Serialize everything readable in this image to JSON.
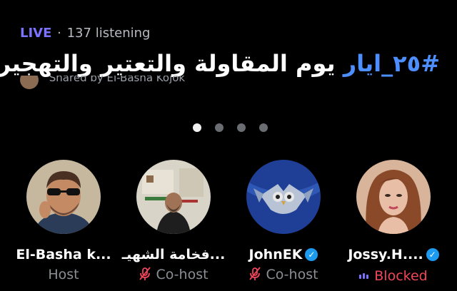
{
  "status": {
    "live": "LIVE",
    "separator": "·",
    "listeners": "137 listening"
  },
  "space_title": {
    "hashtag": "#٢٥_ايار",
    "text": " يوم المقاولة والتعتير والتهجير"
  },
  "shared_by": "Shared by El-Basha Kojok",
  "carousel": {
    "page_count": 4,
    "active_index": 0
  },
  "speakers": [
    {
      "name": "El-Basha k...",
      "role": "Host",
      "verified": false,
      "role_icon": ""
    },
    {
      "name": "فخامة الشهيـ...",
      "role": "Co-host",
      "verified": false,
      "role_icon": "muted-mic-icon"
    },
    {
      "name": "JohnEK",
      "role": "Co-host",
      "verified": true,
      "role_icon": "muted-mic-icon"
    },
    {
      "name": "Jossy.H....",
      "role": "Blocked",
      "verified": true,
      "role_icon": "speaking-bars-icon"
    }
  ],
  "colors": {
    "live": "#7b72ff",
    "hashtag": "#4e8fff",
    "verified": "#1d9bf0",
    "co_host_icon": "#f0455a",
    "blocked": "#f0455a"
  }
}
